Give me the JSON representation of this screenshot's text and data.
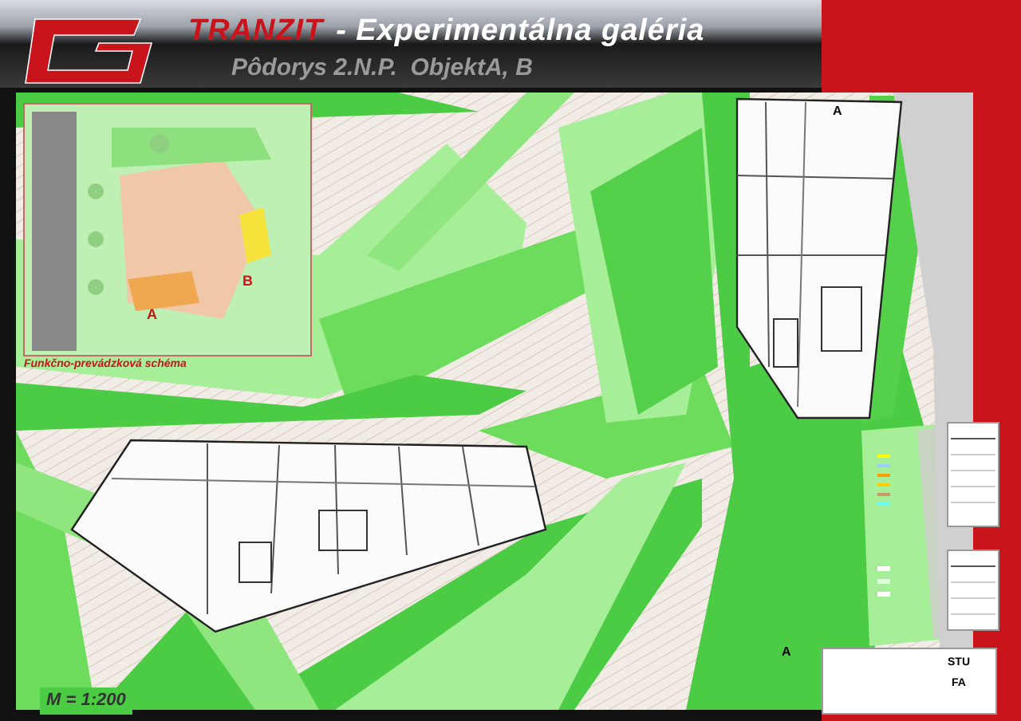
{
  "header": {
    "title_red": "TRANZIT",
    "title_rest": "- Experimentálna galéria",
    "subtitle": "Pôdorys 2.N.P.  ObjektA, B"
  },
  "inset": {
    "caption": "Funkčno-prevádzková schéma",
    "building_labels": [
      "A",
      "B"
    ]
  },
  "section_marks": [
    "A",
    "A"
  ],
  "scale": "M = 1:200",
  "title_block": {
    "school": "STU",
    "faculty": "FA"
  }
}
